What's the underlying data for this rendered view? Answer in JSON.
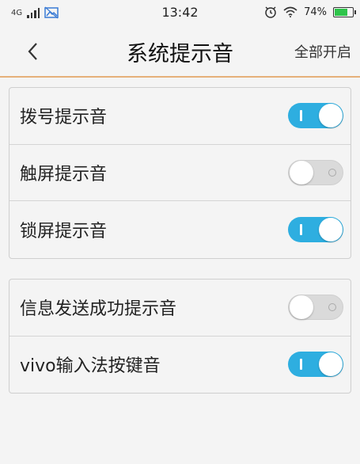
{
  "status_bar": {
    "network": "4G",
    "time": "13:42",
    "battery": "74%",
    "battery_level": 0.74,
    "icons": [
      "signal-icon",
      "image-icon",
      "alarm-icon",
      "wifi-icon",
      "battery-icon"
    ]
  },
  "nav": {
    "back_icon": "chevron-left-icon",
    "title": "系统提示音",
    "action": "全部开启"
  },
  "groups": [
    {
      "items": [
        {
          "label": "拨号提示音",
          "on": true
        },
        {
          "label": "触屏提示音",
          "on": false
        },
        {
          "label": "锁屏提示音",
          "on": true
        }
      ]
    },
    {
      "items": [
        {
          "label": "信息发送成功提示音",
          "on": false
        },
        {
          "label": "vivo输入法按键音",
          "on": true
        }
      ]
    }
  ],
  "colors": {
    "toggle_on": "#2eaee0",
    "toggle_off": "#dadada",
    "nav_divider": "#e6b07a",
    "battery": "#2ec44a"
  }
}
